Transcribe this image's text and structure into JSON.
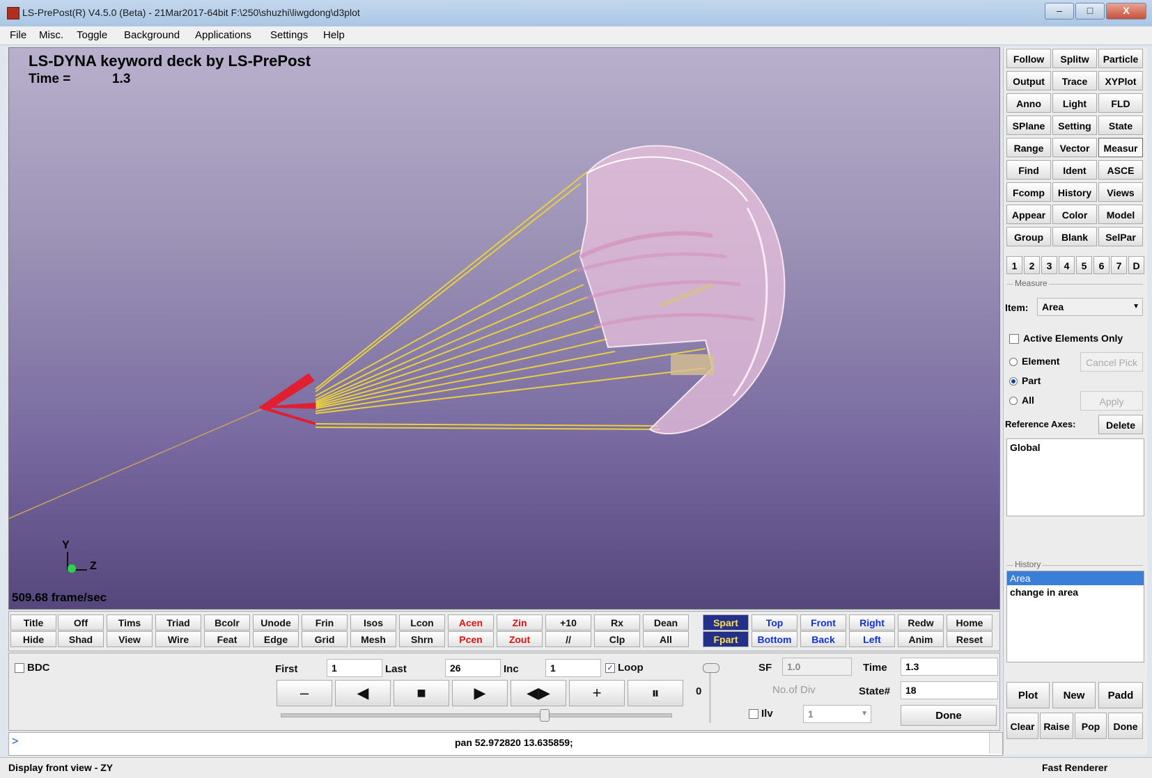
{
  "window": {
    "title": "LS-PrePost(R) V4.5.0 (Beta) - 21Mar2017-64bit F:\\250\\shuzhi\\liwgdong\\d3plot",
    "min": "–",
    "max": "□",
    "close": "X"
  },
  "menu": [
    "File",
    "Misc.",
    "Toggle",
    "Background",
    "Applications",
    "Settings",
    "Help"
  ],
  "viewport": {
    "title": "LS-DYNA keyword deck by LS-PrePost",
    "time_label": "Time =",
    "time_value": "1.3",
    "fps": "509.68 frame/sec",
    "axis_y": "Y",
    "axis_z": "Z",
    "background_top": "#b8b0cc",
    "background_bottom": "#55477c",
    "canopy_color": "#e8b8d8",
    "lines_color": "#e8d040",
    "payload_color": "#e02030"
  },
  "toolbar_row1": [
    "Title",
    "Off",
    "Tims",
    "Triad",
    "Bcolr",
    "Unode",
    "Frin",
    "Isos",
    "Lcon",
    "Acen",
    "Zin",
    "+10",
    "Rx",
    "Dean",
    "Spart",
    "Top",
    "Front",
    "Right",
    "Redw",
    "Home"
  ],
  "toolbar_row2": [
    "Hide",
    "Shad",
    "View",
    "Wire",
    "Feat",
    "Edge",
    "Grid",
    "Mesh",
    "Shrn",
    "Pcen",
    "Zout",
    "//",
    "Clp",
    "All",
    "Fpart",
    "Bottom",
    "Back",
    "Left",
    "Anim",
    "Reset"
  ],
  "animation": {
    "bdc_label": "BDC",
    "first_label": "First",
    "first_value": "1",
    "last_label": "Last",
    "last_value": "26",
    "inc_label": "Inc",
    "inc_value": "1",
    "loop_label": "Loop",
    "loop_checked": true,
    "slider_value": "0",
    "sf_label": "SF",
    "sf_value": "1.0",
    "ndiv_label": "No.of Div",
    "ilv_label": "Ilv",
    "ilv_value": "1",
    "time_label": "Time",
    "time_value": "1.3",
    "state_label": "State#",
    "state_value": "18",
    "done_label": "Done",
    "buttons": [
      "–",
      "◀",
      "■",
      "▶",
      "◀▶",
      "+",
      "⏸"
    ]
  },
  "command": {
    "prompt": ">",
    "text": "pan 52.972820 13.635859;"
  },
  "status": {
    "left": "Display front view - ZY",
    "right": "Fast Renderer"
  },
  "right_panel": {
    "buttons": [
      [
        "Follow",
        "Splitw",
        "Particle"
      ],
      [
        "Output",
        "Trace",
        "XYPlot"
      ],
      [
        "Anno",
        "Light",
        "FLD"
      ],
      [
        "SPlane",
        "Setting",
        "State"
      ],
      [
        "Range",
        "Vector",
        "Measur"
      ],
      [
        "Find",
        "Ident",
        "ASCE"
      ],
      [
        "Fcomp",
        "History",
        "Views"
      ],
      [
        "Appear",
        "Color",
        "Model"
      ],
      [
        "Group",
        "Blank",
        "SelPar"
      ]
    ],
    "page_numbers": [
      "1",
      "2",
      "3",
      "4",
      "5",
      "6",
      "7",
      "D"
    ],
    "measure_title": "Measure",
    "item_label": "Item:",
    "item_value": "Area",
    "active_only": "Active Elements Only",
    "radio_element": "Element",
    "radio_part": "Part",
    "radio_all": "All",
    "cancel_pick": "Cancel Pick",
    "apply": "Apply",
    "ref_axes_label": "Reference Axes:",
    "delete": "Delete",
    "ref_axes_value": "Global",
    "history_title": "History",
    "history_items": [
      "Area",
      "change in area"
    ],
    "bottom_row1": [
      "Plot",
      "New",
      "Padd"
    ],
    "bottom_row2": [
      "Clear",
      "Raise",
      "Pop",
      "Done"
    ]
  }
}
